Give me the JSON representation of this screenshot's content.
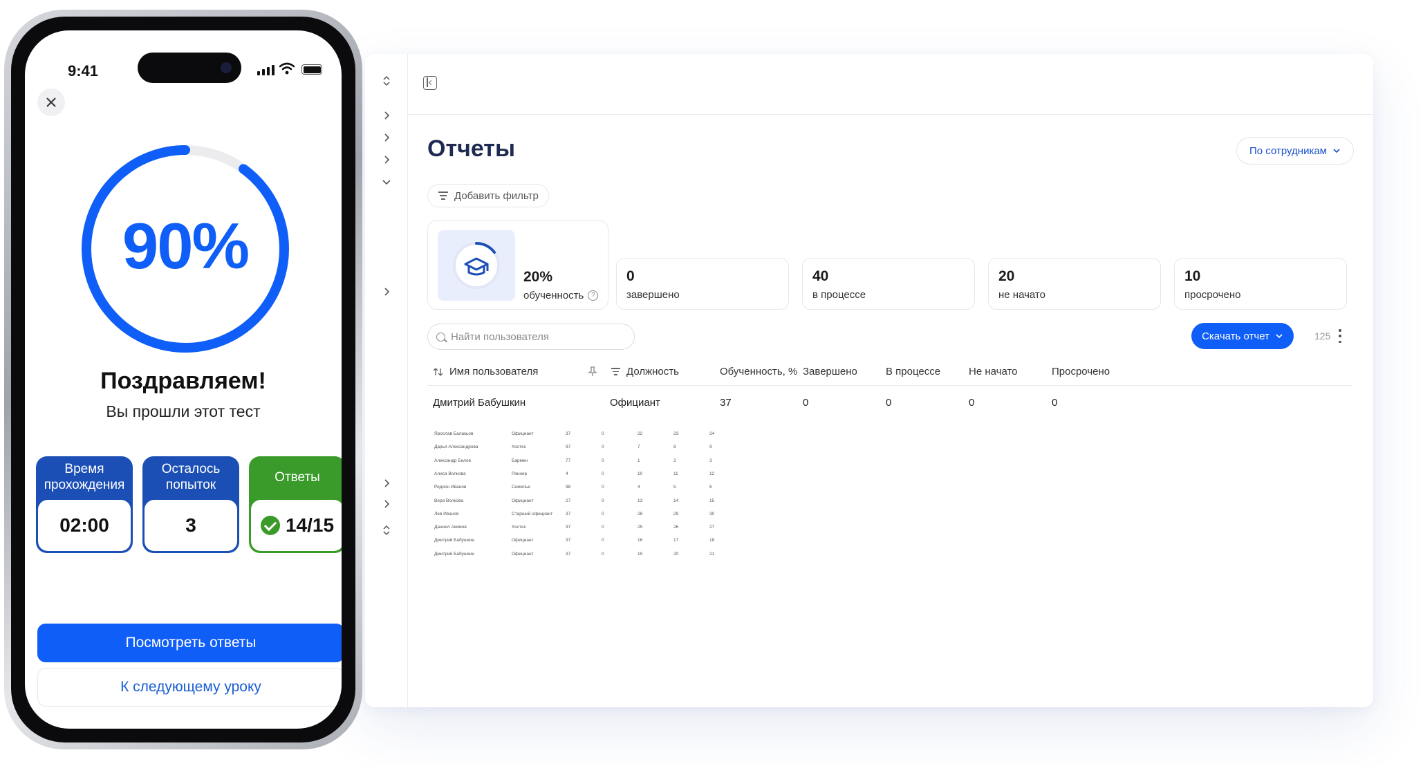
{
  "desktop": {
    "title": "Отчеты",
    "view_select": "По сотрудникам",
    "add_filter": "Добавить фильтр",
    "stats": {
      "main": {
        "value": "20%",
        "label": "обученность"
      },
      "cards": [
        {
          "value": "0",
          "label": "завершено"
        },
        {
          "value": "40",
          "label": "в процессе"
        },
        {
          "value": "20",
          "label": "не начато"
        },
        {
          "value": "10",
          "label": "просрочено"
        }
      ]
    },
    "search_placeholder": "Найти пользователя",
    "download_label": "Скачать отчет",
    "count": "125",
    "table": {
      "headers": [
        "Имя пользователя",
        "Должность",
        "Обученность, %",
        "Завершено",
        "В процессе",
        "Не начато",
        "Просрочено"
      ],
      "main_row": [
        "Дмитрий Бабушкин",
        "Официант",
        "37",
        "0",
        "0",
        "0",
        "0"
      ],
      "mini_rows": [
        [
          "Ярослав Балакьов",
          "Официант",
          "37",
          "0",
          "22",
          "23",
          "24"
        ],
        [
          "Дарья Александрова",
          "Хостес",
          "97",
          "0",
          "7",
          "8",
          "9"
        ],
        [
          "Александр Белов",
          "Бармен",
          "77",
          "0",
          "1",
          "2",
          "3"
        ],
        [
          "Алиса Волкова",
          "Раннер",
          "4",
          "0",
          "10",
          "11",
          "12"
        ],
        [
          "Родион Иванов",
          "Сомелье",
          "98",
          "0",
          "4",
          "5",
          "6"
        ],
        [
          "Вера Волкова",
          "Официант",
          "27",
          "0",
          "13",
          "14",
          "15"
        ],
        [
          "Лев Иванов",
          "Старший официант",
          "37",
          "0",
          "28",
          "29",
          "30"
        ],
        [
          "Даниил Акимов",
          "Хостес",
          "37",
          "0",
          "25",
          "26",
          "27"
        ],
        [
          "Дмитрий Бабушкин",
          "Официант",
          "37",
          "0",
          "16",
          "17",
          "18"
        ],
        [
          "Дмитрий Бабушкин",
          "Официант",
          "37",
          "0",
          "19",
          "20",
          "21"
        ]
      ]
    }
  },
  "phone": {
    "time": "9:41",
    "progress_value": 0.9,
    "progress_label": "90%",
    "congrats": "Поздравляем!",
    "subtitle": "Вы прошли этот тест",
    "tiles": [
      {
        "title": "Время прохождения",
        "value": "02:00"
      },
      {
        "title": "Осталось попыток",
        "value": "3"
      },
      {
        "title": "Ответы",
        "value": "14/15"
      }
    ],
    "primary_button": "Посмотреть ответы",
    "secondary_button": "К следующему уроку"
  },
  "colors": {
    "accent": "#0f5ef7",
    "tile_blue": "#1c4fb6",
    "tile_green": "#3a9a2a",
    "title_navy": "#1e2a52"
  },
  "icons": [
    "close-icon",
    "chevron-right-icon",
    "chevron-down-icon",
    "sort-icon",
    "filter-icon",
    "search-icon",
    "pin-icon",
    "graduation-cap-icon",
    "help-icon",
    "check-icon",
    "kebab-icon",
    "sidebar-toggle-icon"
  ]
}
